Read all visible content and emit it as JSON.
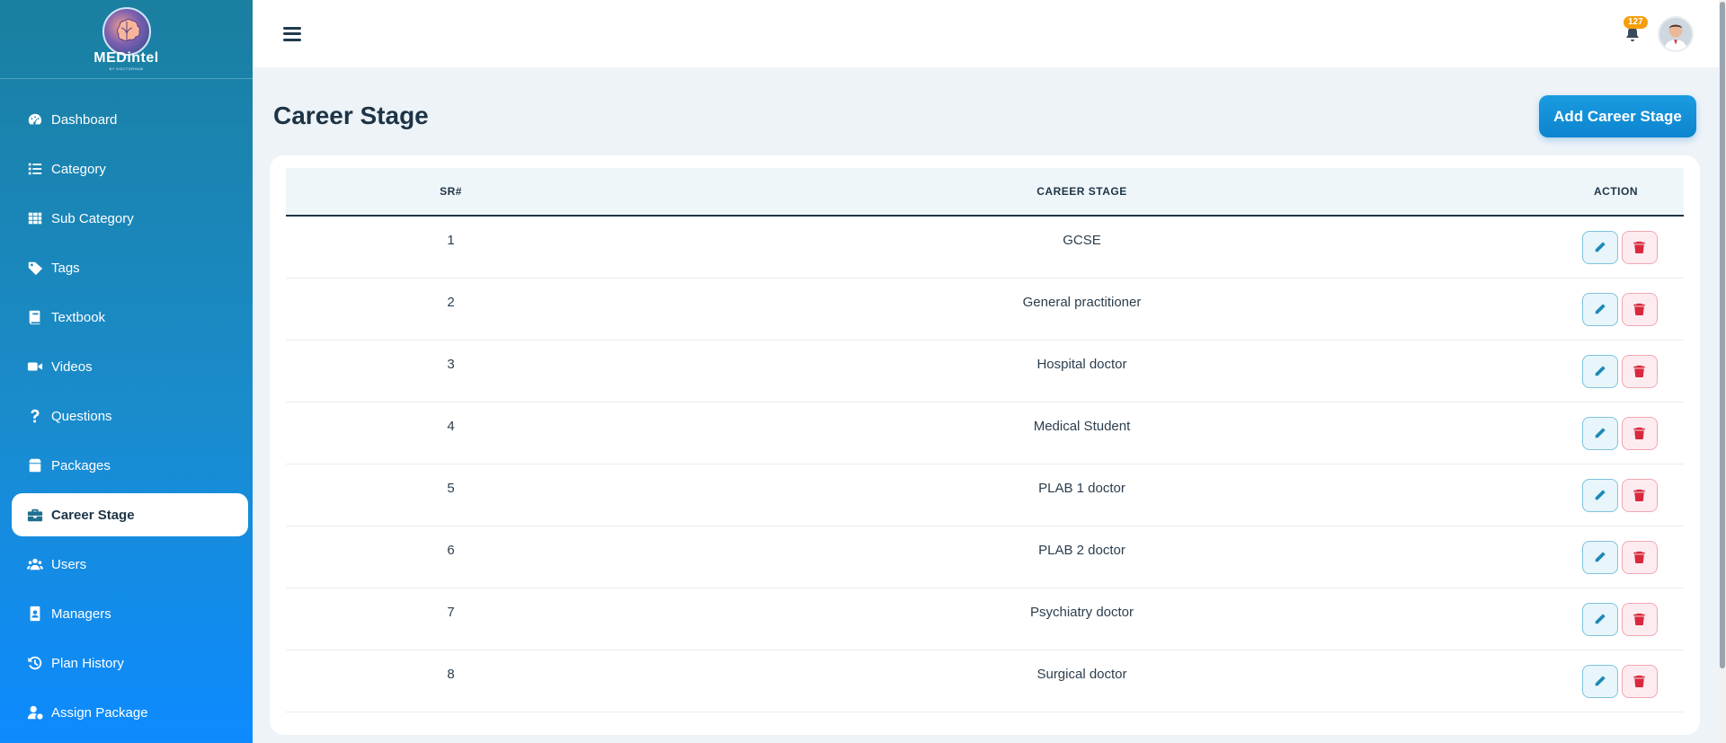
{
  "brand": {
    "name": "MEDintel",
    "tagline": "BY DOCTORHUB"
  },
  "sidebar": {
    "items": [
      {
        "label": "Dashboard",
        "icon": "gauge-icon"
      },
      {
        "label": "Category",
        "icon": "list-icon"
      },
      {
        "label": "Sub Category",
        "icon": "grid-icon"
      },
      {
        "label": "Tags",
        "icon": "tag-icon"
      },
      {
        "label": "Textbook",
        "icon": "book-icon"
      },
      {
        "label": "Videos",
        "icon": "video-icon"
      },
      {
        "label": "Questions",
        "icon": "question-icon"
      },
      {
        "label": "Packages",
        "icon": "box-icon"
      },
      {
        "label": "Career Stage",
        "icon": "briefcase-icon",
        "active": true
      },
      {
        "label": "Users",
        "icon": "users-icon"
      },
      {
        "label": "Managers",
        "icon": "id-badge-icon"
      },
      {
        "label": "Plan History",
        "icon": "history-icon"
      },
      {
        "label": "Assign Package",
        "icon": "user-gear-icon"
      }
    ]
  },
  "header": {
    "notification_count": "127"
  },
  "page": {
    "title": "Career Stage",
    "add_button_label": "Add Career Stage"
  },
  "table": {
    "columns": {
      "sr": "SR#",
      "stage": "CAREER STAGE",
      "action": "ACTION"
    },
    "rows": [
      {
        "sr": "1",
        "stage": "GCSE"
      },
      {
        "sr": "2",
        "stage": "General practitioner"
      },
      {
        "sr": "3",
        "stage": "Hospital doctor"
      },
      {
        "sr": "4",
        "stage": "Medical Student"
      },
      {
        "sr": "5",
        "stage": "PLAB 1 doctor"
      },
      {
        "sr": "6",
        "stage": "PLAB 2 doctor"
      },
      {
        "sr": "7",
        "stage": "Psychiatry doctor"
      },
      {
        "sr": "8",
        "stage": "Surgical doctor"
      }
    ]
  },
  "colors": {
    "accent": "#0d84cf",
    "edit": "#1b8ab7",
    "delete": "#d9293f",
    "badge": "#f59e0b"
  }
}
